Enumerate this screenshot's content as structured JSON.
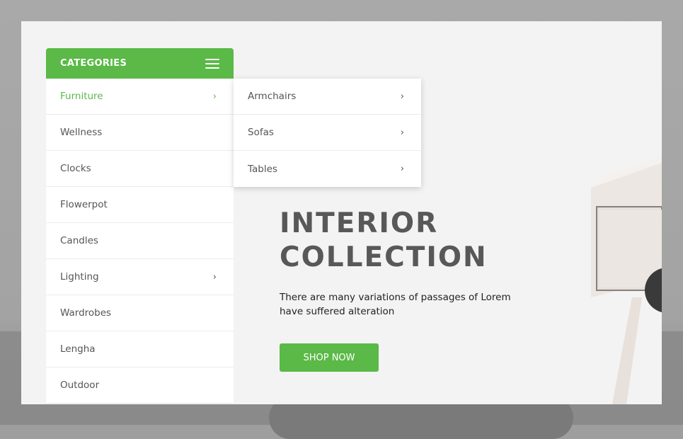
{
  "categories": {
    "title": "CATEGORIES",
    "menu_icon": "hamburger-icon",
    "accent_color": "#5ab947",
    "items": [
      {
        "label": "Furniture",
        "active": true,
        "has_children": true
      },
      {
        "label": "Wellness",
        "active": false,
        "has_children": false
      },
      {
        "label": "Clocks",
        "active": false,
        "has_children": false
      },
      {
        "label": "Flowerpot",
        "active": false,
        "has_children": false
      },
      {
        "label": "Candles",
        "active": false,
        "has_children": false
      },
      {
        "label": "Lighting",
        "active": false,
        "has_children": true
      },
      {
        "label": "Wardrobes",
        "active": false,
        "has_children": false
      },
      {
        "label": "Lengha",
        "active": false,
        "has_children": false
      },
      {
        "label": "Outdoor",
        "active": false,
        "has_children": false
      }
    ]
  },
  "submenu": {
    "items": [
      {
        "label": "Armchairs",
        "has_children": true
      },
      {
        "label": "Sofas",
        "has_children": true
      },
      {
        "label": "Tables",
        "has_children": true
      }
    ]
  },
  "hero": {
    "title_line1": "INTERIOR",
    "title_line2": "COLLECTION",
    "description": "There are many variations of passages of Lorem have suffered alteration",
    "button_label": "SHOP NOW"
  }
}
